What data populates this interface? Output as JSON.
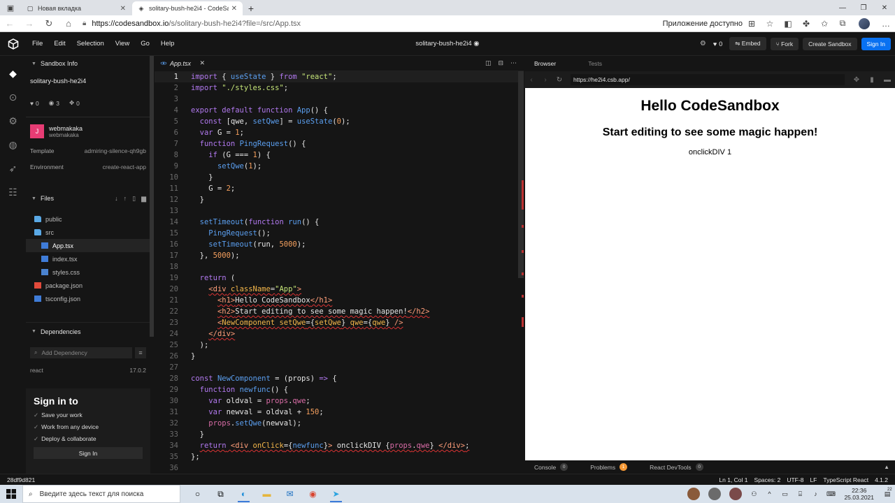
{
  "browser": {
    "tabs": [
      {
        "label": "Новая вкладка",
        "active": false
      },
      {
        "label": "solitary-bush-he2i4 - CodeSandbox",
        "active": true
      }
    ],
    "url_host": "https://codesandbox.io",
    "url_path": "/s/solitary-bush-he2i4?file=/src/App.tsx",
    "app_available": "Приложение доступно"
  },
  "header": {
    "menu": [
      "File",
      "Edit",
      "Selection",
      "View",
      "Go",
      "Help"
    ],
    "project_name": "solitary-bush-he2i4",
    "likes": "0",
    "embed": "Embed",
    "fork": "Fork",
    "create_sandbox": "Create Sandbox",
    "sign_in": "Sign In"
  },
  "sidebar": {
    "info_title": "Sandbox Info",
    "sandbox_name": "solitary-bush-he2i4",
    "likes": "0",
    "views": "3",
    "forks": "0",
    "author_initial": "J",
    "author_name": "webmakaka",
    "author_user": "webmakaka",
    "template_label": "Template",
    "template_value": "admiring-silence-qh9gb",
    "env_label": "Environment",
    "env_value": "create-react-app",
    "files_title": "Files",
    "files": [
      {
        "name": "public",
        "type": "folder",
        "indent": 0,
        "selected": false
      },
      {
        "name": "src",
        "type": "folder",
        "indent": 0,
        "selected": false
      },
      {
        "name": "App.tsx",
        "type": "tsx",
        "indent": 1,
        "selected": true
      },
      {
        "name": "index.tsx",
        "type": "tsx",
        "indent": 1,
        "selected": false
      },
      {
        "name": "styles.css",
        "type": "css",
        "indent": 1,
        "selected": false
      },
      {
        "name": "package.json",
        "type": "json",
        "indent": 0,
        "selected": false
      },
      {
        "name": "tsconfig.json",
        "type": "tsx",
        "indent": 0,
        "selected": false
      }
    ],
    "deps_title": "Dependencies",
    "dep_placeholder": "Add Dependency",
    "deps": [
      {
        "name": "react",
        "version": "17.0.2"
      }
    ],
    "signin_title": "Sign in to",
    "signin_points": [
      "Save your work",
      "Work from any device",
      "Deploy & collaborate"
    ],
    "signin_button": "Sign In"
  },
  "editor": {
    "tab": "App.tsx",
    "current_line": 1,
    "lines": [
      [
        [
          "kw",
          "import"
        ],
        [
          "vr",
          " { "
        ],
        [
          "fn",
          "useState"
        ],
        [
          "vr",
          " } "
        ],
        [
          "kw",
          "from"
        ],
        [
          "vr",
          " "
        ],
        [
          "st",
          "\"react\""
        ],
        [
          "vr",
          ";"
        ]
      ],
      [
        [
          "kw",
          "import"
        ],
        [
          "vr",
          " "
        ],
        [
          "st",
          "\"./styles.css\""
        ],
        [
          "vr",
          ";"
        ]
      ],
      [],
      [
        [
          "kw",
          "export default function"
        ],
        [
          "vr",
          " "
        ],
        [
          "fn",
          "App"
        ],
        [
          "vr",
          "() {"
        ]
      ],
      [
        [
          "vr",
          "  "
        ],
        [
          "kw",
          "const"
        ],
        [
          "vr",
          " [qwe, "
        ],
        [
          "fn",
          "setQwe"
        ],
        [
          "vr",
          "] = "
        ],
        [
          "fn",
          "useState"
        ],
        [
          "vr",
          "("
        ],
        [
          "nu",
          "0"
        ],
        [
          "vr",
          ");"
        ]
      ],
      [
        [
          "vr",
          "  "
        ],
        [
          "kw",
          "var"
        ],
        [
          "vr",
          " G = "
        ],
        [
          "nu",
          "1"
        ],
        [
          "vr",
          ";"
        ]
      ],
      [
        [
          "vr",
          "  "
        ],
        [
          "kw",
          "function"
        ],
        [
          "vr",
          " "
        ],
        [
          "fn",
          "PingRequest"
        ],
        [
          "vr",
          "() {"
        ]
      ],
      [
        [
          "vr",
          "    "
        ],
        [
          "kw",
          "if"
        ],
        [
          "vr",
          " (G === "
        ],
        [
          "nu",
          "1"
        ],
        [
          "vr",
          ") {"
        ]
      ],
      [
        [
          "vr",
          "      "
        ],
        [
          "fn",
          "setQwe"
        ],
        [
          "vr",
          "("
        ],
        [
          "nu",
          "1"
        ],
        [
          "vr",
          ");"
        ]
      ],
      [
        [
          "vr",
          "    }"
        ]
      ],
      [
        [
          "vr",
          "    G = "
        ],
        [
          "nu",
          "2"
        ],
        [
          "vr",
          ";"
        ]
      ],
      [
        [
          "vr",
          "  }"
        ]
      ],
      [],
      [
        [
          "vr",
          "  "
        ],
        [
          "fn",
          "setTimeout"
        ],
        [
          "vr",
          "("
        ],
        [
          "kw",
          "function"
        ],
        [
          "vr",
          " "
        ],
        [
          "fn",
          "run"
        ],
        [
          "vr",
          "() {"
        ]
      ],
      [
        [
          "vr",
          "    "
        ],
        [
          "fn",
          "PingRequest"
        ],
        [
          "vr",
          "();"
        ]
      ],
      [
        [
          "vr",
          "    "
        ],
        [
          "fn",
          "setTimeout"
        ],
        [
          "vr",
          "(run, "
        ],
        [
          "nu",
          "5000"
        ],
        [
          "vr",
          ");"
        ]
      ],
      [
        [
          "vr",
          "  }, "
        ],
        [
          "nu",
          "5000"
        ],
        [
          "vr",
          ");"
        ]
      ],
      [],
      [
        [
          "vr",
          "  "
        ],
        [
          "kw",
          "return"
        ],
        [
          "vr",
          " ("
        ]
      ],
      [
        [
          "vr",
          "    "
        ],
        [
          "tg",
          "<div"
        ],
        [
          "vr",
          " "
        ],
        [
          "at",
          "className"
        ],
        [
          "vr",
          "="
        ],
        [
          "st",
          "\"App\""
        ],
        [
          "tg",
          ">"
        ]
      ],
      [
        [
          "vr",
          "      "
        ],
        [
          "tg",
          "<h1>"
        ],
        [
          "vr",
          "Hello CodeSandbox"
        ],
        [
          "tg",
          "</h1>"
        ]
      ],
      [
        [
          "vr",
          "      "
        ],
        [
          "tg",
          "<h2>"
        ],
        [
          "vr",
          "Start editing to see some magic happen!"
        ],
        [
          "tg",
          "</h2>"
        ]
      ],
      [
        [
          "vr",
          "      "
        ],
        [
          "tg",
          "<"
        ],
        [
          "at",
          "NewComponent"
        ],
        [
          "vr",
          " "
        ],
        [
          "at",
          "setQwe"
        ],
        [
          "vr",
          "={"
        ],
        [
          "at",
          "setQwe"
        ],
        [
          "vr",
          "} "
        ],
        [
          "at",
          "qwe"
        ],
        [
          "vr",
          "={"
        ],
        [
          "at",
          "qwe"
        ],
        [
          "vr",
          "} "
        ],
        [
          "tg",
          "/>"
        ]
      ],
      [
        [
          "vr",
          "    "
        ],
        [
          "tg",
          "</div>"
        ]
      ],
      [
        [
          "vr",
          "  );"
        ]
      ],
      [
        [
          "vr",
          "}"
        ]
      ],
      [],
      [
        [
          "kw",
          "const"
        ],
        [
          "vr",
          " "
        ],
        [
          "fn",
          "NewComponent"
        ],
        [
          "vr",
          " = (props) "
        ],
        [
          "kw",
          "=>"
        ],
        [
          "vr",
          " {"
        ]
      ],
      [
        [
          "vr",
          "  "
        ],
        [
          "kw",
          "function"
        ],
        [
          "vr",
          " "
        ],
        [
          "fn",
          "newfunc"
        ],
        [
          "vr",
          "() {"
        ]
      ],
      [
        [
          "vr",
          "    "
        ],
        [
          "kw",
          "var"
        ],
        [
          "vr",
          " oldval = "
        ],
        [
          "pr",
          "props"
        ],
        [
          "vr",
          "."
        ],
        [
          "pr",
          "qwe"
        ],
        [
          "vr",
          ";"
        ]
      ],
      [
        [
          "vr",
          "    "
        ],
        [
          "kw",
          "var"
        ],
        [
          "vr",
          " newval = oldval + "
        ],
        [
          "nu",
          "150"
        ],
        [
          "vr",
          ";"
        ]
      ],
      [
        [
          "vr",
          "    "
        ],
        [
          "pr",
          "props"
        ],
        [
          "vr",
          "."
        ],
        [
          "fn",
          "setQwe"
        ],
        [
          "vr",
          "(newval);"
        ]
      ],
      [
        [
          "vr",
          "  }"
        ]
      ],
      [
        [
          "vr",
          "  "
        ],
        [
          "kw",
          "return"
        ],
        [
          "vr",
          " "
        ],
        [
          "tg",
          "<div"
        ],
        [
          "vr",
          " "
        ],
        [
          "at",
          "onClick"
        ],
        [
          "vr",
          "={"
        ],
        [
          "fn",
          "newfunc"
        ],
        [
          "vr",
          "}"
        ],
        [
          "tg",
          ">"
        ],
        [
          "vr",
          " onclickDIV {"
        ],
        [
          "pr",
          "props"
        ],
        [
          "vr",
          "."
        ],
        [
          "pr",
          "qwe"
        ],
        [
          "vr",
          "} "
        ],
        [
          "tg",
          "</div>"
        ],
        [
          "vr",
          ";"
        ]
      ],
      [
        [
          "vr",
          "};"
        ]
      ],
      []
    ],
    "squiggle_lines": [
      20,
      21,
      22,
      23,
      24,
      34
    ]
  },
  "preview": {
    "tab_browser": "Browser",
    "tab_tests": "Tests",
    "url": "https://he2i4.csb.app/",
    "h1": "Hello CodeSandbox",
    "h2": "Start editing to see some magic happen!",
    "div": "onclickDIV 1",
    "console_label": "Console",
    "console_count": "0",
    "problems_label": "Problems",
    "problems_count": "1",
    "devtools_label": "React DevTools",
    "devtools_count": "0"
  },
  "status": {
    "sha": "28df9d821",
    "position": "Ln 1, Col 1",
    "spaces": "Spaces: 2",
    "encoding": "UTF-8",
    "eol": "LF",
    "language": "TypeScript React",
    "version": "4.1.2"
  },
  "taskbar": {
    "search_placeholder": "Введите здесь текст для поиска",
    "time": "22:36",
    "date": "25.03.2021",
    "notif_count": "22"
  },
  "colors": {
    "accent_blue": "#0971f1",
    "author_pink": "#e63c74",
    "problem_orange": "#f69935"
  }
}
